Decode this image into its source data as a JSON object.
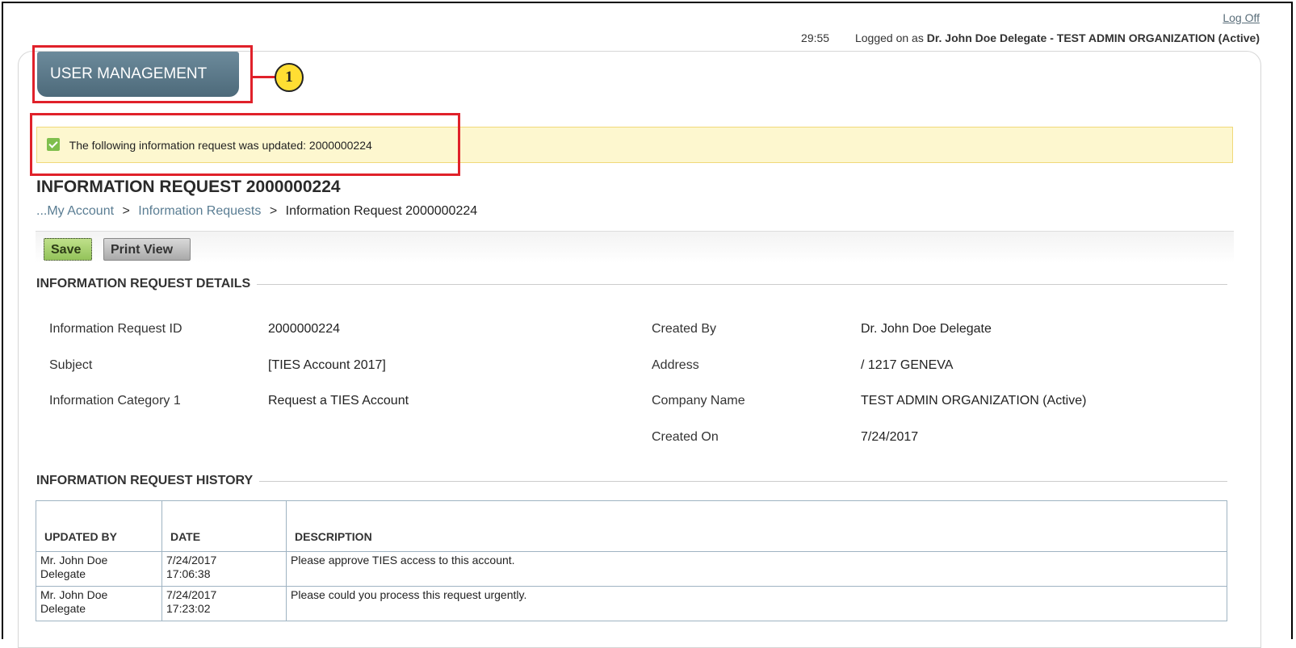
{
  "header": {
    "logoff": "Log Off",
    "timer": "29:55",
    "logged_on_prefix": "Logged on as",
    "user": "Dr. John Doe Delegate - TEST ADMIN ORGANIZATION (Active)"
  },
  "nav": {
    "user_management": "USER MANAGEMENT"
  },
  "callouts": {
    "c1": "1"
  },
  "notice": {
    "text": "The following information request was updated: 2000000224"
  },
  "page": {
    "title": "INFORMATION REQUEST 2000000224",
    "breadcrumb": [
      {
        "label": "...My Account"
      },
      {
        "label": "Information Requests"
      },
      {
        "label": "Information Request 2000000224"
      }
    ],
    "breadcrumb_sep": ">"
  },
  "toolbar": {
    "save": "Save",
    "print_view": "Print View"
  },
  "details": {
    "section_title": "INFORMATION REQUEST DETAILS",
    "left": [
      {
        "label": "Information Request ID",
        "value": "2000000224"
      },
      {
        "label": "Subject",
        "value": "[TIES Account 2017]"
      },
      {
        "label": "Information Category 1",
        "value": "Request a TIES Account"
      }
    ],
    "right": [
      {
        "label": "Created By",
        "value": "Dr. John Doe Delegate"
      },
      {
        "label": "Address",
        "value": "/ 1217 GENEVA"
      },
      {
        "label": "Company Name",
        "value": "TEST ADMIN ORGANIZATION (Active)"
      },
      {
        "label": "Created On",
        "value": "7/24/2017"
      }
    ]
  },
  "history": {
    "section_title": "INFORMATION REQUEST HISTORY",
    "columns": [
      "UPDATED BY",
      "DATE",
      "DESCRIPTION"
    ],
    "rows": [
      {
        "updated_by_1": "Mr. John Doe",
        "updated_by_2": "Delegate",
        "date_1": "7/24/2017",
        "date_2": "17:06:38",
        "description": "Please approve TIES access to this account."
      },
      {
        "updated_by_1": "Mr. John Doe",
        "updated_by_2": "Delegate",
        "date_1": "7/24/2017",
        "date_2": "17:23:02",
        "description": "Please could you process this request urgently."
      }
    ]
  },
  "colors": {
    "highlight_red": "#e0212a",
    "callout_yellow": "#ffde33",
    "nav_button": "#5a7888",
    "save_green": "#9fcb65",
    "notice_bg": "#fdf7cf"
  }
}
